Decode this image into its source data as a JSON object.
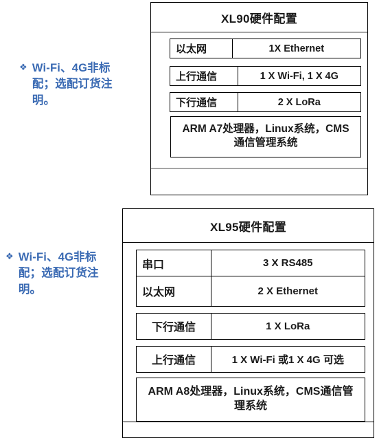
{
  "notes": [
    {
      "bullet": "diamond-bullet-icon",
      "glyph": "❖",
      "text": "Wi-Fi、4G非标配；选配订货注明。",
      "color": "#3A6AB3"
    },
    {
      "bullet": "diamond-bullet-icon",
      "glyph": "❖",
      "text": "Wi-Fi、4G非标配；选配订货注明。",
      "color": "#3A6AB3"
    }
  ],
  "panels": [
    {
      "id": "xl90",
      "title": "XL90硬件配置",
      "rows": [
        {
          "label": "以太网",
          "value": "1X Ethernet"
        },
        {
          "label": "上行通信",
          "value": "1 X Wi-Fi, 1 X 4G"
        },
        {
          "label": "下行通信",
          "value": "2 X LoRa"
        }
      ],
      "summary": "ARM A7处理器，Linux系统，CMS通信管理系统"
    },
    {
      "id": "xl95",
      "title": "XL95硬件配置",
      "rows": [
        {
          "label": "串口",
          "value": "3 X RS485"
        },
        {
          "label": "以太网",
          "value": "2 X Ethernet"
        },
        {
          "label": "下行通信",
          "value": "1 X LoRa"
        },
        {
          "label": "上行通信",
          "value": "1 X Wi-Fi 或1 X 4G 可选"
        }
      ],
      "summary": "ARM A8处理器，Linux系统，CMS通信管理系统"
    }
  ],
  "colors": {
    "accent_blue": "#3A6AB3",
    "border_black": "#000000",
    "divider_gray": "#A6A6A6",
    "background": "#FFFFFF"
  }
}
